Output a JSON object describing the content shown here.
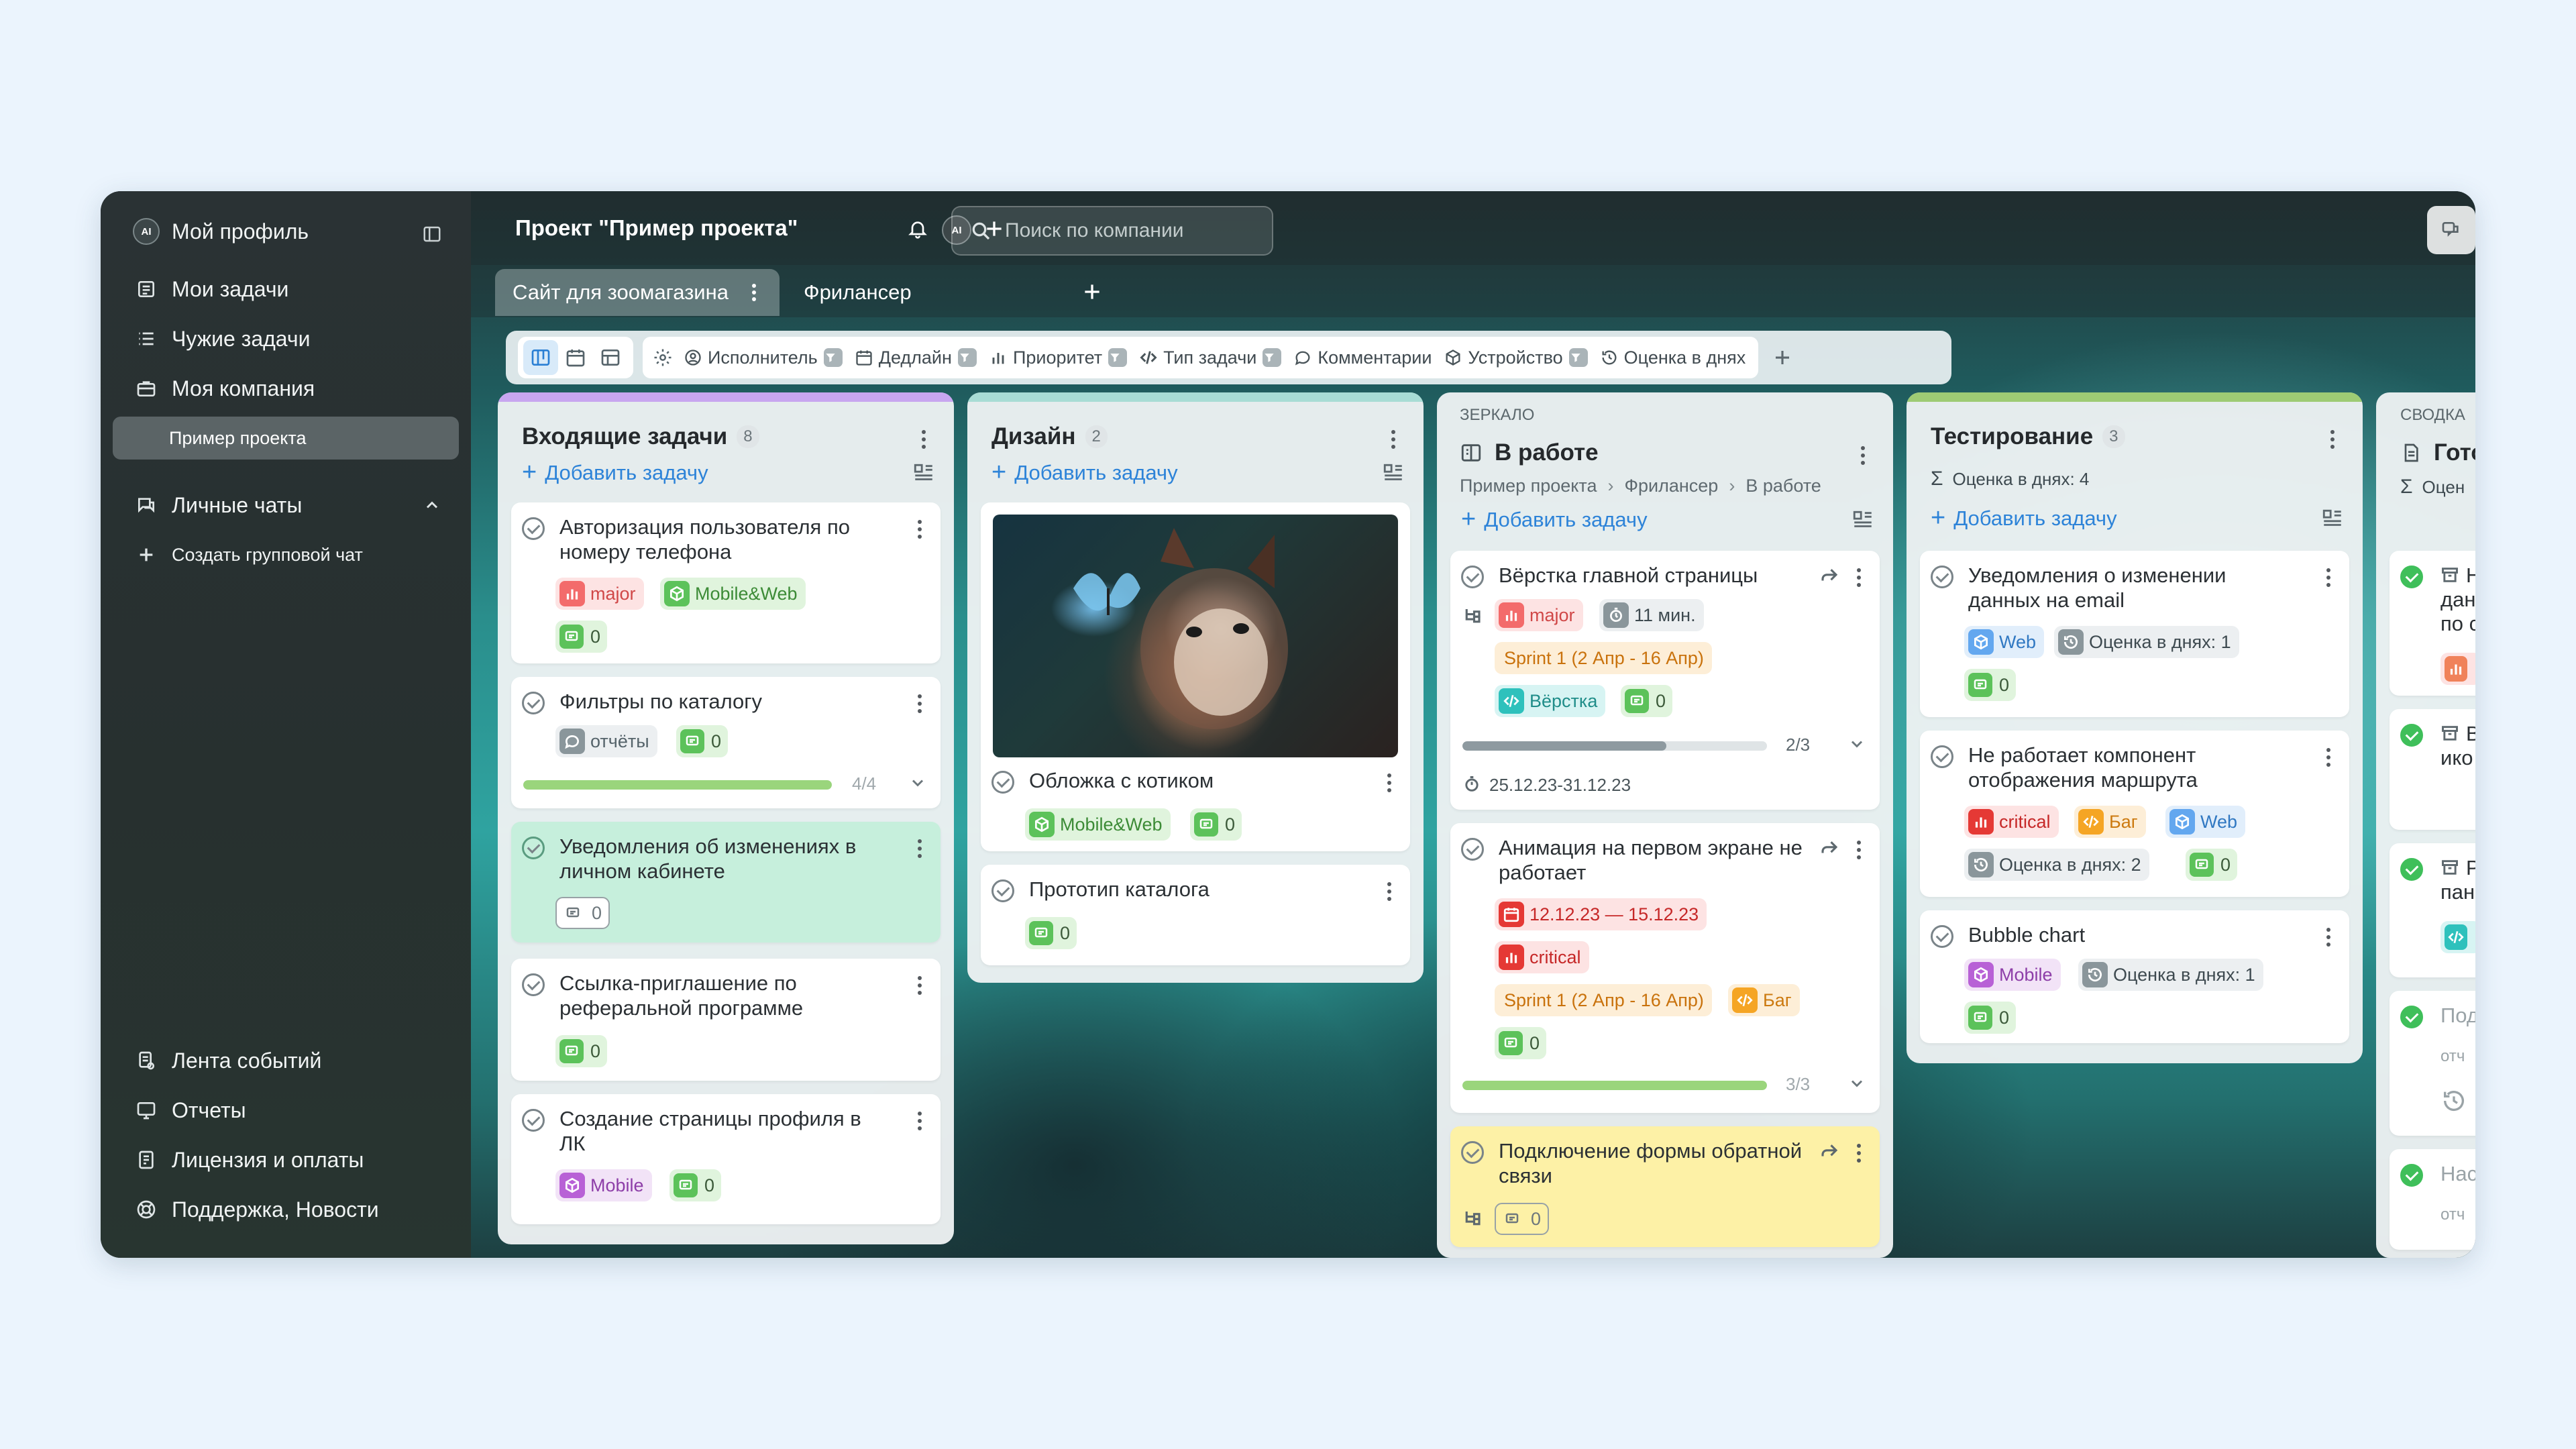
{
  "sidebar": {
    "avatar": "AI",
    "profile": "Мой профиль",
    "items": [
      {
        "label": "Мои задачи",
        "icon": "checklist-icon"
      },
      {
        "label": "Чужие задачи",
        "icon": "list-icon"
      },
      {
        "label": "Моя компания",
        "icon": "briefcase-icon"
      }
    ],
    "project": "Пример проекта",
    "chats": "Личные чаты",
    "create_chat": "Создать групповой чат",
    "bottom": [
      {
        "label": "Лента событий",
        "icon": "feed-icon"
      },
      {
        "label": "Отчеты",
        "icon": "report-icon"
      },
      {
        "label": "Лицензия и оплаты",
        "icon": "license-icon"
      },
      {
        "label": "Поддержка, Новости",
        "icon": "support-icon"
      }
    ]
  },
  "header": {
    "title": "Проект \"Пример проекта\"",
    "avatar": "AI",
    "search_placeholder": "Поиск по компании"
  },
  "tabs": [
    {
      "label": "Сайт для зоомагазина",
      "active": true
    },
    {
      "label": "Фрилансер",
      "active": false
    }
  ],
  "filters": [
    "Исполнитель",
    "Дедлайн",
    "Приоритет",
    "Тип задачи",
    "Комментарии",
    "Устройство",
    "Оценка в днях"
  ],
  "columns": {
    "incoming": {
      "title": "Входящие задачи",
      "count": "8",
      "add": "Добавить задачу",
      "color": "#c8a6f0",
      "cards": [
        {
          "title": "Авторизация пользователя по номеру телефона",
          "tags": [
            "major",
            "Mobile&Web"
          ],
          "comments": "0"
        },
        {
          "title": "Фильтры по каталогу",
          "tags": [
            "отчёты"
          ],
          "comments": "0",
          "progress": "4/4"
        },
        {
          "title": "Уведомления об изменениях в личном кабинете",
          "comments": "0"
        },
        {
          "title": "Ссылка-приглашение по реферальной программе",
          "comments": "0"
        },
        {
          "title": "Создание страницы профиля в ЛК",
          "tags": [
            "Mobile"
          ],
          "comments": "0"
        }
      ]
    },
    "design": {
      "title": "Дизайн",
      "count": "2",
      "add": "Добавить задачу",
      "color": "#a8dcd5",
      "cards": [
        {
          "title": "Обложка с котиком",
          "tags": [
            "Mobile&Web"
          ],
          "comments": "0"
        },
        {
          "title": "Прототип каталога",
          "comments": "0"
        }
      ]
    },
    "inwork": {
      "label": "ЗЕРКАЛО",
      "title": "В работе",
      "add": "Добавить задачу",
      "crumbs": [
        "Пример проекта",
        "Фрилансер",
        "В работе"
      ],
      "cards": [
        {
          "title": "Вёрстка главной страницы",
          "tags": [
            "major",
            "11 мин.",
            "Sprint 1 (2 Апр - 16 Апр)",
            "Вёрстка"
          ],
          "comments": "0",
          "progress": "2/3",
          "dates": "25.12.23-31.12.23"
        },
        {
          "title": "Анимация на первом экране не работает",
          "tags": [
            "12.12.23 — 15.12.23",
            "critical",
            "Sprint 1 (2 Апр - 16 Апр)",
            "Баг"
          ],
          "comments": "0",
          "progress": "3/3"
        },
        {
          "title": "Подключение формы обратной связи",
          "comments": "0"
        }
      ]
    },
    "testing": {
      "title": "Тестирование",
      "count": "3",
      "estimate": "Оценка в днях: 4",
      "add": "Добавить задачу",
      "color": "#9ecb74",
      "cards": [
        {
          "title": "Уведомления о изменении данных на email",
          "tags": [
            "Web",
            "Оценка в днях: 1"
          ],
          "comments": "0"
        },
        {
          "title": "Не работает компонент отображения маршрута",
          "tags": [
            "critical",
            "Баг",
            "Web",
            "Оценка в днях: 2"
          ],
          "comments": "0"
        },
        {
          "title": "Bubble chart",
          "tags": [
            "Mobile",
            "Оценка в днях: 1"
          ],
          "comments": "0"
        }
      ]
    },
    "summary": {
      "label": "СВОДКА",
      "title": "Гото",
      "estimate": "Оцен",
      "cards": [
        {
          "lines": [
            "Н",
            "дан",
            "по с"
          ]
        },
        {
          "lines": [
            "В",
            "ико"
          ]
        },
        {
          "lines": [
            "Р",
            "пан"
          ]
        },
        {
          "lines": [
            "Под",
            "отч"
          ]
        },
        {
          "lines": [
            "Нас",
            "отч"
          ]
        }
      ]
    }
  }
}
